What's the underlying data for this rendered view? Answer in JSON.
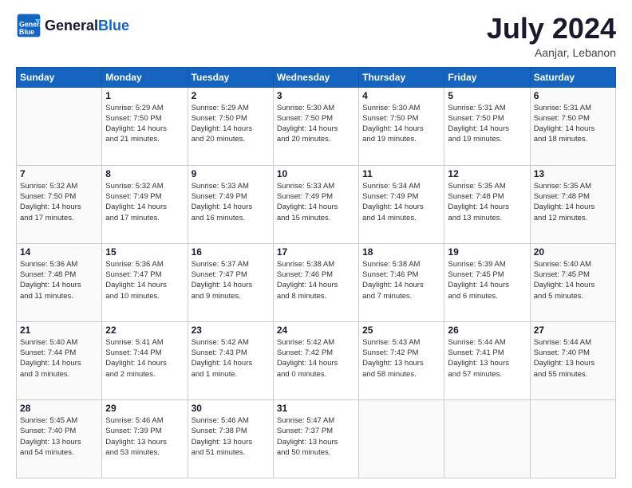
{
  "header": {
    "logo_line1": "General",
    "logo_line2": "Blue",
    "month": "July 2024",
    "location": "Aanjar, Lebanon"
  },
  "weekdays": [
    "Sunday",
    "Monday",
    "Tuesday",
    "Wednesday",
    "Thursday",
    "Friday",
    "Saturday"
  ],
  "weeks": [
    [
      {
        "day": "",
        "info": ""
      },
      {
        "day": "1",
        "info": "Sunrise: 5:29 AM\nSunset: 7:50 PM\nDaylight: 14 hours\nand 21 minutes."
      },
      {
        "day": "2",
        "info": "Sunrise: 5:29 AM\nSunset: 7:50 PM\nDaylight: 14 hours\nand 20 minutes."
      },
      {
        "day": "3",
        "info": "Sunrise: 5:30 AM\nSunset: 7:50 PM\nDaylight: 14 hours\nand 20 minutes."
      },
      {
        "day": "4",
        "info": "Sunrise: 5:30 AM\nSunset: 7:50 PM\nDaylight: 14 hours\nand 19 minutes."
      },
      {
        "day": "5",
        "info": "Sunrise: 5:31 AM\nSunset: 7:50 PM\nDaylight: 14 hours\nand 19 minutes."
      },
      {
        "day": "6",
        "info": "Sunrise: 5:31 AM\nSunset: 7:50 PM\nDaylight: 14 hours\nand 18 minutes."
      }
    ],
    [
      {
        "day": "7",
        "info": "Sunrise: 5:32 AM\nSunset: 7:50 PM\nDaylight: 14 hours\nand 17 minutes."
      },
      {
        "day": "8",
        "info": "Sunrise: 5:32 AM\nSunset: 7:49 PM\nDaylight: 14 hours\nand 17 minutes."
      },
      {
        "day": "9",
        "info": "Sunrise: 5:33 AM\nSunset: 7:49 PM\nDaylight: 14 hours\nand 16 minutes."
      },
      {
        "day": "10",
        "info": "Sunrise: 5:33 AM\nSunset: 7:49 PM\nDaylight: 14 hours\nand 15 minutes."
      },
      {
        "day": "11",
        "info": "Sunrise: 5:34 AM\nSunset: 7:49 PM\nDaylight: 14 hours\nand 14 minutes."
      },
      {
        "day": "12",
        "info": "Sunrise: 5:35 AM\nSunset: 7:48 PM\nDaylight: 14 hours\nand 13 minutes."
      },
      {
        "day": "13",
        "info": "Sunrise: 5:35 AM\nSunset: 7:48 PM\nDaylight: 14 hours\nand 12 minutes."
      }
    ],
    [
      {
        "day": "14",
        "info": "Sunrise: 5:36 AM\nSunset: 7:48 PM\nDaylight: 14 hours\nand 11 minutes."
      },
      {
        "day": "15",
        "info": "Sunrise: 5:36 AM\nSunset: 7:47 PM\nDaylight: 14 hours\nand 10 minutes."
      },
      {
        "day": "16",
        "info": "Sunrise: 5:37 AM\nSunset: 7:47 PM\nDaylight: 14 hours\nand 9 minutes."
      },
      {
        "day": "17",
        "info": "Sunrise: 5:38 AM\nSunset: 7:46 PM\nDaylight: 14 hours\nand 8 minutes."
      },
      {
        "day": "18",
        "info": "Sunrise: 5:38 AM\nSunset: 7:46 PM\nDaylight: 14 hours\nand 7 minutes."
      },
      {
        "day": "19",
        "info": "Sunrise: 5:39 AM\nSunset: 7:45 PM\nDaylight: 14 hours\nand 6 minutes."
      },
      {
        "day": "20",
        "info": "Sunrise: 5:40 AM\nSunset: 7:45 PM\nDaylight: 14 hours\nand 5 minutes."
      }
    ],
    [
      {
        "day": "21",
        "info": "Sunrise: 5:40 AM\nSunset: 7:44 PM\nDaylight: 14 hours\nand 3 minutes."
      },
      {
        "day": "22",
        "info": "Sunrise: 5:41 AM\nSunset: 7:44 PM\nDaylight: 14 hours\nand 2 minutes."
      },
      {
        "day": "23",
        "info": "Sunrise: 5:42 AM\nSunset: 7:43 PM\nDaylight: 14 hours\nand 1 minute."
      },
      {
        "day": "24",
        "info": "Sunrise: 5:42 AM\nSunset: 7:42 PM\nDaylight: 14 hours\nand 0 minutes."
      },
      {
        "day": "25",
        "info": "Sunrise: 5:43 AM\nSunset: 7:42 PM\nDaylight: 13 hours\nand 58 minutes."
      },
      {
        "day": "26",
        "info": "Sunrise: 5:44 AM\nSunset: 7:41 PM\nDaylight: 13 hours\nand 57 minutes."
      },
      {
        "day": "27",
        "info": "Sunrise: 5:44 AM\nSunset: 7:40 PM\nDaylight: 13 hours\nand 55 minutes."
      }
    ],
    [
      {
        "day": "28",
        "info": "Sunrise: 5:45 AM\nSunset: 7:40 PM\nDaylight: 13 hours\nand 54 minutes."
      },
      {
        "day": "29",
        "info": "Sunrise: 5:46 AM\nSunset: 7:39 PM\nDaylight: 13 hours\nand 53 minutes."
      },
      {
        "day": "30",
        "info": "Sunrise: 5:46 AM\nSunset: 7:38 PM\nDaylight: 13 hours\nand 51 minutes."
      },
      {
        "day": "31",
        "info": "Sunrise: 5:47 AM\nSunset: 7:37 PM\nDaylight: 13 hours\nand 50 minutes."
      },
      {
        "day": "",
        "info": ""
      },
      {
        "day": "",
        "info": ""
      },
      {
        "day": "",
        "info": ""
      }
    ]
  ]
}
